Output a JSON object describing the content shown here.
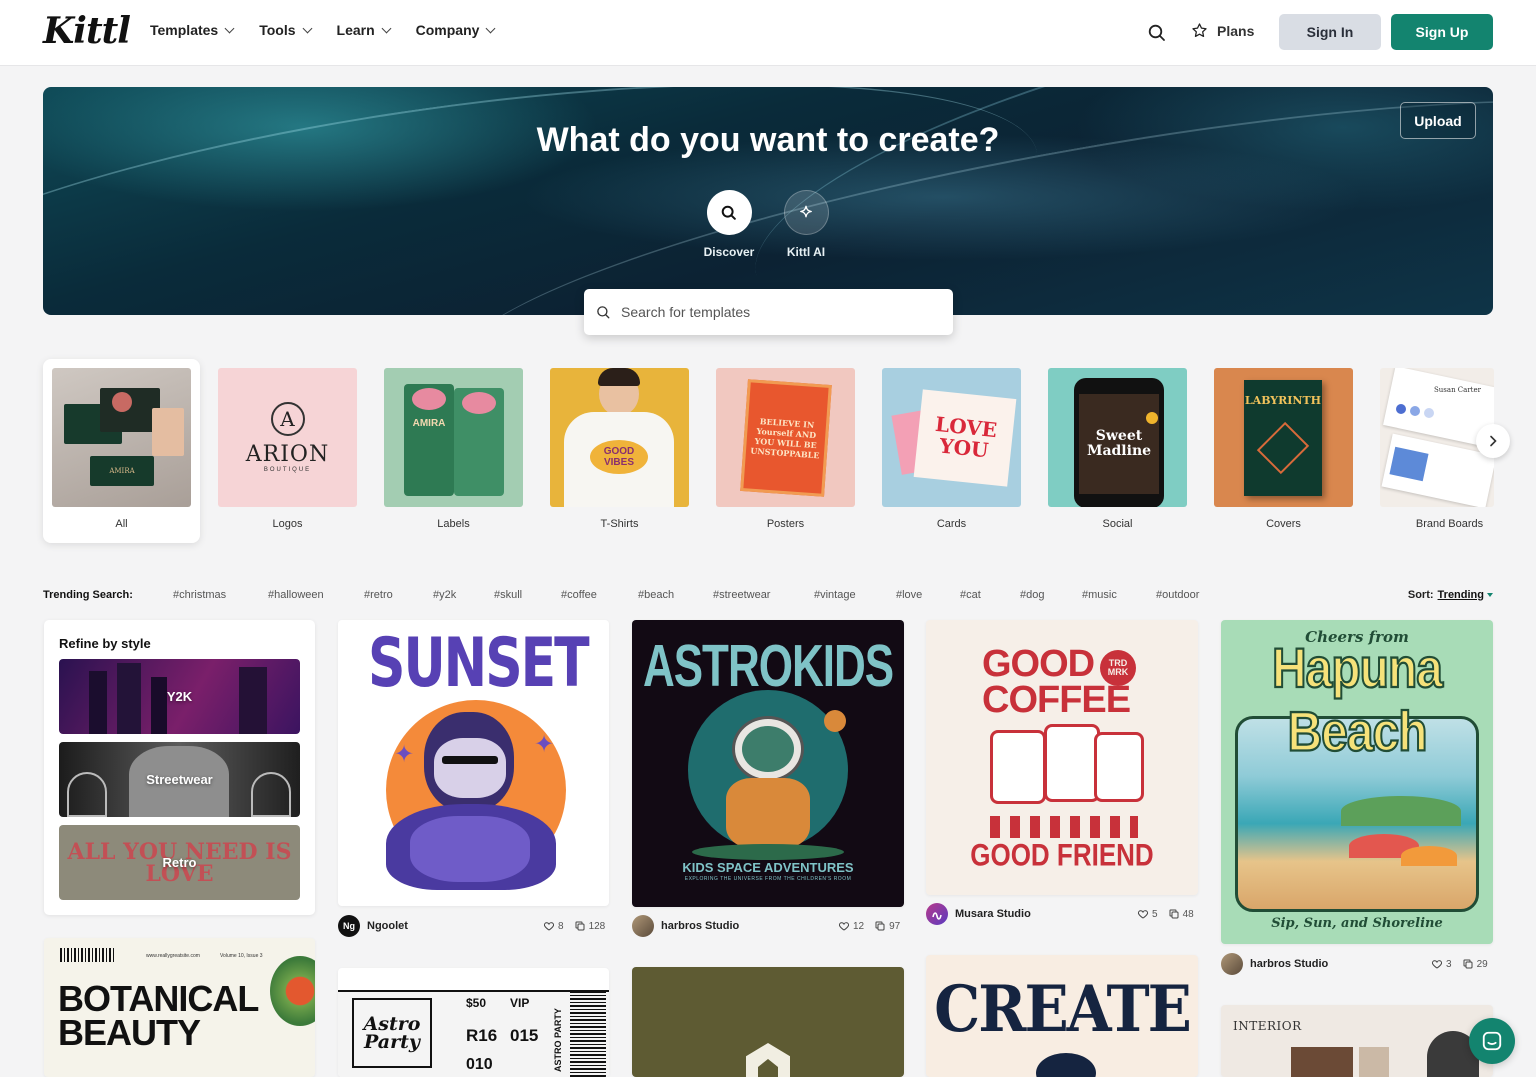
{
  "header": {
    "logo": "Kittl",
    "nav": [
      {
        "label": "Templates"
      },
      {
        "label": "Tools"
      },
      {
        "label": "Learn"
      },
      {
        "label": "Company"
      }
    ],
    "plans_label": "Plans",
    "signin_label": "Sign In",
    "signup_label": "Sign Up"
  },
  "hero": {
    "title": "What do you want to create?",
    "upload_label": "Upload",
    "modes": [
      {
        "label": "Discover",
        "icon": "search-icon"
      },
      {
        "label": "Kittl AI",
        "icon": "sparkle-icon"
      }
    ],
    "search_placeholder": "Search for templates"
  },
  "categories": [
    {
      "label": "All",
      "active": true,
      "thumb_text": "AMIRA"
    },
    {
      "label": "Logos",
      "thumb_text": "ARION",
      "thumb_sub": "BOUTIQUE"
    },
    {
      "label": "Labels",
      "thumb_text": "AMIRA"
    },
    {
      "label": "T-Shirts",
      "thumb_text": "GOOD VIBES"
    },
    {
      "label": "Posters",
      "thumb_text": "BELIEVE IN Yourself AND YOU WILL BE UNSTOPPABLE"
    },
    {
      "label": "Cards",
      "thumb_text": "LOVE YOU"
    },
    {
      "label": "Social",
      "thumb_text": "Sweet Madline"
    },
    {
      "label": "Covers",
      "thumb_text": "LABYRINTH"
    },
    {
      "label": "Brand Boards",
      "thumb_text": "Susan Carter"
    }
  ],
  "trending": {
    "label": "Trending Search:",
    "tags": [
      "#christmas",
      "#halloween",
      "#retro",
      "#y2k",
      "#skull",
      "#coffee",
      "#beach",
      "#streetwear",
      "#vintage",
      "#love",
      "#cat",
      "#dog",
      "#music",
      "#outdoor"
    ],
    "sort_label": "Sort:",
    "sort_value": "Trending"
  },
  "refine": {
    "title": "Refine by style",
    "styles": [
      {
        "label": "Y2K"
      },
      {
        "label": "Streetwear"
      },
      {
        "label": "Retro",
        "bg_text": "ALL YOU NEED IS LOVE"
      }
    ]
  },
  "cards": [
    {
      "title_text": "SUNSET",
      "author": "Ngoolet",
      "avatar": "Ng",
      "likes": "8",
      "copies": "128"
    },
    {
      "title_text": "ASTROKIDS",
      "subtitle": "KIDS SPACE ADVENTURES",
      "tagline": "EXPLORING THE UNIVERSE FROM THE CHILDREN'S ROOM",
      "author": "harbros Studio",
      "likes": "12",
      "copies": "97"
    },
    {
      "title_text": "GOOD COFFEE",
      "badge": "TRD MRK",
      "footer_text": "GOOD FRIEND",
      "author": "Musara Studio",
      "likes": "5",
      "copies": "48"
    },
    {
      "title_text": "Hapuna Beach",
      "top_text": "Cheers from",
      "bottom_text": "Sip, Sun, and Shoreline",
      "author": "harbros Studio",
      "likes": "3",
      "copies": "29"
    },
    {
      "title_text": "BOTANICAL BEAUTY",
      "top_left": "www.reallygreatsite.com",
      "top_right": "Volume 10, Issue 3"
    },
    {
      "title_text": "Astro Party",
      "ticket": [
        "$50",
        "VIP",
        "R16",
        "015",
        "010"
      ],
      "footer_text": "ASTRO PARTY"
    },
    {
      "title_text": ""
    },
    {
      "title_text": "CREATE"
    },
    {
      "title_text": "INTERIOR"
    }
  ],
  "colors": {
    "accent": "#13846f",
    "signin_bg": "#d9dde4"
  }
}
